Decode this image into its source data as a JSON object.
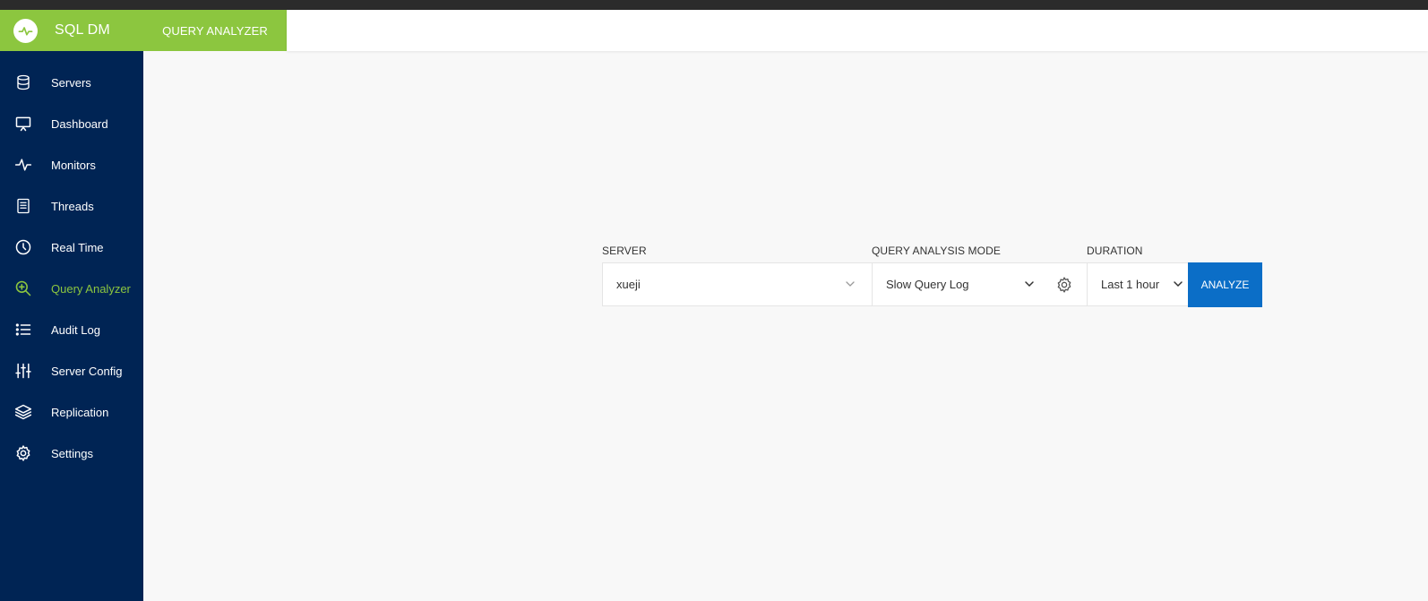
{
  "app": {
    "name": "SQL DM",
    "header_tab": "QUERY ANALYZER"
  },
  "sidebar": {
    "items": [
      {
        "label": "Servers",
        "icon": "database-icon"
      },
      {
        "label": "Dashboard",
        "icon": "monitor-icon"
      },
      {
        "label": "Monitors",
        "icon": "pulse-icon"
      },
      {
        "label": "Threads",
        "icon": "document-icon"
      },
      {
        "label": "Real Time",
        "icon": "clock-icon"
      },
      {
        "label": "Query Analyzer",
        "icon": "zoom-in-icon",
        "active": true
      },
      {
        "label": "Audit Log",
        "icon": "list-icon"
      },
      {
        "label": "Server Config",
        "icon": "sliders-icon"
      },
      {
        "label": "Replication",
        "icon": "layers-icon"
      },
      {
        "label": "Settings",
        "icon": "gear-icon"
      }
    ]
  },
  "form": {
    "server_label": "SERVER",
    "server_value": "xueji",
    "mode_label": "QUERY ANALYSIS MODE",
    "mode_value": "Slow Query Log",
    "duration_label": "DURATION",
    "duration_value": "Last 1 hour",
    "analyze_label": "ANALYZE"
  },
  "colors": {
    "brand_green": "#8cc63f",
    "sidebar_bg": "#002454",
    "accent_blue": "#0b6ec7",
    "page_bg": "#f8f8f8"
  }
}
